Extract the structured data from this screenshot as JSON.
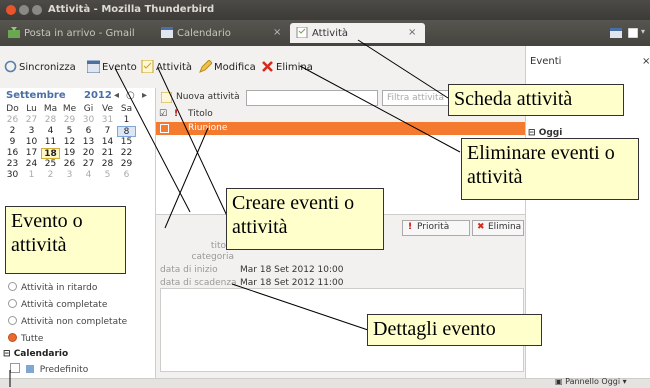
{
  "window": {
    "title": "Attività - Mozilla Thunderbird"
  },
  "tabs": [
    {
      "label": "Posta in arrivo - Gmail"
    },
    {
      "label": "Calendario",
      "close": "×"
    },
    {
      "label": "Attività",
      "close": "×"
    }
  ],
  "toolbar": {
    "sync": "Sincronizza",
    "event": "Evento",
    "task": "Attività",
    "modify": "Modifica",
    "delete": "Elimina"
  },
  "calendar": {
    "month": "Settembre",
    "year": "2012",
    "nav_prev": "◂",
    "nav_today": "○",
    "nav_next": "▸",
    "weekdays": [
      "Do",
      "Lu",
      "Ma",
      "Me",
      "Gi",
      "Ve",
      "Sa"
    ],
    "weeks": [
      [
        "26",
        "27",
        "28",
        "29",
        "30",
        "31",
        "1"
      ],
      [
        "2",
        "3",
        "4",
        "5",
        "6",
        "7",
        "8"
      ],
      [
        "9",
        "10",
        "11",
        "12",
        "13",
        "14",
        "15"
      ],
      [
        "16",
        "17",
        "18",
        "19",
        "20",
        "21",
        "22"
      ],
      [
        "23",
        "24",
        "25",
        "26",
        "27",
        "28",
        "29"
      ],
      [
        "30",
        "1",
        "2",
        "3",
        "4",
        "5",
        "6"
      ]
    ],
    "today": "18",
    "selected": "8"
  },
  "filters": [
    "Attività in ritardo",
    "Attività completate",
    "Attività non completate",
    "Tutte"
  ],
  "calendars_section": {
    "title": "Calendario",
    "items": [
      "Predefinito"
    ]
  },
  "tasks": {
    "new_task": "Nuova attività",
    "filter_placeholder": "Filtra attività",
    "col_title": "Titolo",
    "rows": [
      {
        "title": "Riunione"
      }
    ]
  },
  "details": {
    "priority_btn": "Priorità",
    "delete_btn": "Elimina",
    "title_label": "titolo",
    "category_label": "categoria",
    "start_label": "data di inizio",
    "start_value": "Mar 18 Set 2012 10:00",
    "due_label": "data di scadenza",
    "due_value": "Mar 18 Set 2012 11:00"
  },
  "events_pane": {
    "title": "Eventi",
    "close": "×",
    "today_header": "Oggi"
  },
  "statusbar": {
    "today_pane": "Pannello Oggi"
  },
  "callouts": {
    "tab": "Scheda attività",
    "delete": "Eliminare eventi o attività",
    "create": "Creare eventi o attività",
    "event_task": "Evento o attività",
    "details": "Dettagli evento"
  }
}
